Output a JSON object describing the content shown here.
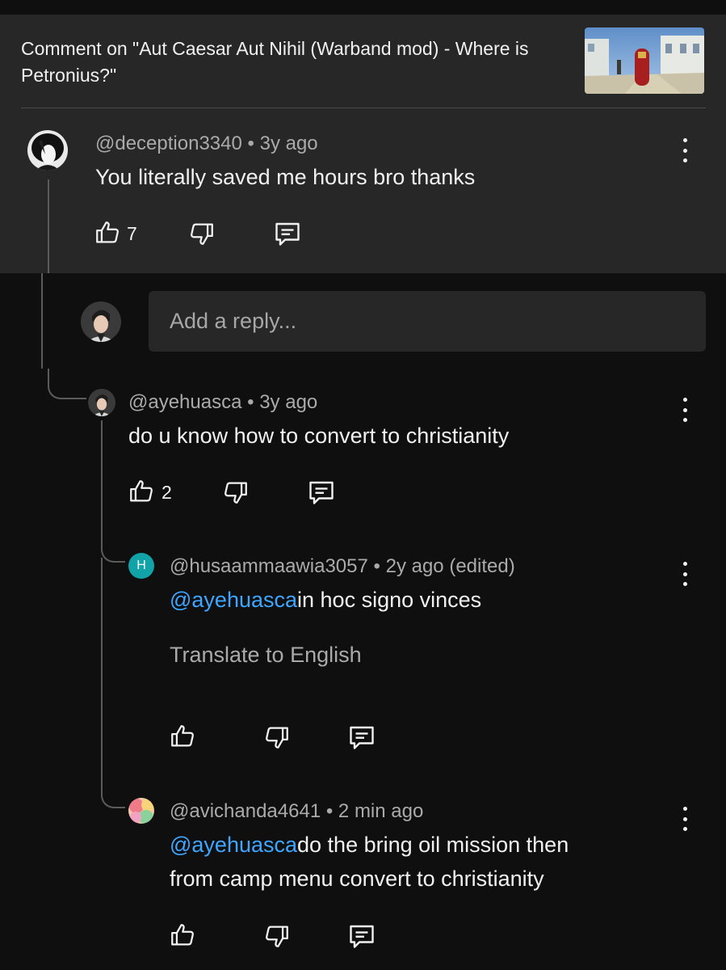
{
  "header": {
    "title": "Comment on \"Aut Caesar Aut Nihil (Warband mod) - Where is Petronius?\""
  },
  "comment": {
    "author": "@deception3340",
    "time": "3y ago",
    "text": "You literally saved me hours bro thanks",
    "likes": "7"
  },
  "reply_input": {
    "placeholder": "Add a reply..."
  },
  "replies": [
    {
      "author": "@ayehuasca",
      "time": "3y ago",
      "text": "do u know how to convert to christianity",
      "likes": "2"
    },
    {
      "author": "@husaammaawia3057",
      "avatar_letter": "H",
      "time": "2y ago (edited)",
      "mention": "@ayehuasca",
      "text": "in hoc signo vinces",
      "translate": "Translate to English"
    },
    {
      "author": "@avichanda4641",
      "time": "2 min ago",
      "mention": "@ayehuasca",
      "text_line1": "do the bring oil mission then",
      "text_line2": "from camp menu convert to christianity"
    }
  ],
  "separator": "•",
  "colors": {
    "background": "#0f0f0f",
    "panel": "#272727",
    "mention": "#3ea6ff",
    "muted": "#aaaaaa"
  },
  "icons": [
    "thumbs-up-icon",
    "thumbs-down-icon",
    "reply-icon",
    "more-vert-icon"
  ]
}
